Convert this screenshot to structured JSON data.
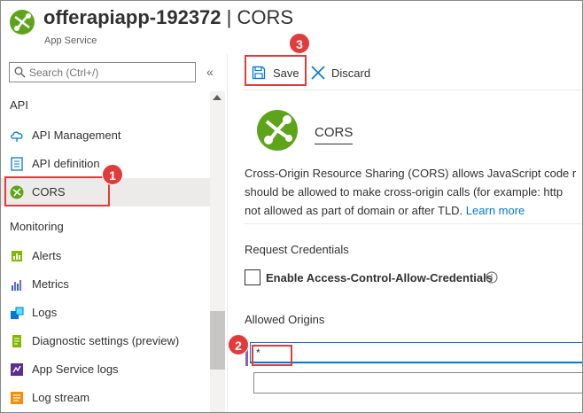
{
  "header": {
    "title_app": "offerapiapp-192372",
    "title_separator": " | ",
    "title_page": "CORS",
    "subtitle": "App Service"
  },
  "sidebar": {
    "search_placeholder": "Search (Ctrl+/)",
    "collapse_glyph": "«",
    "sections": [
      {
        "title": "API",
        "items": [
          {
            "label": "API Management",
            "icon": "cloud-api-icon"
          },
          {
            "label": "API definition",
            "icon": "document-icon"
          },
          {
            "label": "CORS",
            "icon": "cors-icon",
            "selected": true
          }
        ]
      },
      {
        "title": "Monitoring",
        "items": [
          {
            "label": "Alerts",
            "icon": "alerts-icon"
          },
          {
            "label": "Metrics",
            "icon": "metrics-icon"
          },
          {
            "label": "Logs",
            "icon": "logs-icon"
          },
          {
            "label": "Diagnostic settings (preview)",
            "icon": "diagnostic-icon"
          },
          {
            "label": "App Service logs",
            "icon": "app-service-logs-icon"
          },
          {
            "label": "Log stream",
            "icon": "log-stream-icon"
          }
        ]
      }
    ]
  },
  "toolbar": {
    "save_label": "Save",
    "discard_label": "Discard"
  },
  "main": {
    "heading": "CORS",
    "description_lines": [
      "Cross-Origin Resource Sharing (CORS) allows JavaScript code r",
      "should be allowed to make cross-origin calls (for example: http",
      "not allowed as part of domain or after TLD."
    ],
    "learn_more": "Learn more",
    "request_credentials_label": "Request Credentials",
    "enable_credentials_label": "Enable Access-Control-Allow-Credentials",
    "enable_credentials_checked": false,
    "allowed_origins_label": "Allowed Origins",
    "origins": [
      "*",
      ""
    ]
  },
  "callouts": [
    "1",
    "2",
    "3"
  ],
  "colors": {
    "accent": "#0078d4",
    "callout": "#e23b3b",
    "cors_green": "#5ea41b"
  }
}
